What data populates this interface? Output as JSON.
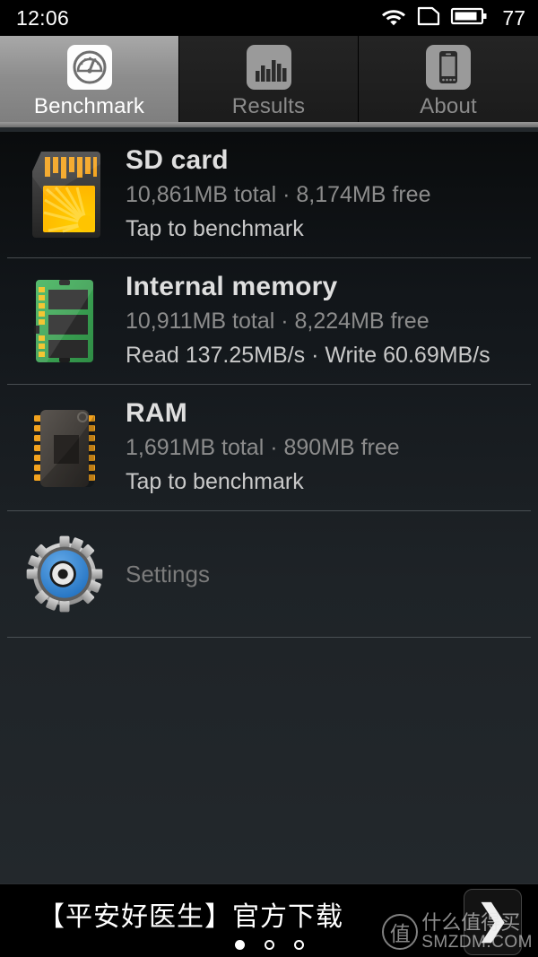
{
  "status_bar": {
    "time": "12:06",
    "battery_percent": "77",
    "icons": [
      "wifi-icon",
      "sim-card-icon",
      "battery-icon"
    ]
  },
  "tabs": [
    {
      "label": "Benchmark",
      "icon": "speedometer-icon",
      "active": true
    },
    {
      "label": "Results",
      "icon": "bar-chart-icon",
      "active": false
    },
    {
      "label": "About",
      "icon": "phone-icon",
      "active": false
    }
  ],
  "list": [
    {
      "id": "sd-card",
      "icon": "sd-card-icon",
      "title": "SD card",
      "subtitle": "10,861MB total · 8,174MB free",
      "action": "Tap to benchmark"
    },
    {
      "id": "internal-memory",
      "icon": "memory-module-icon",
      "title": "Internal memory",
      "subtitle": "10,911MB total · 8,224MB free",
      "action": "Read 137.25MB/s · Write 60.69MB/s"
    },
    {
      "id": "ram",
      "icon": "ram-chip-icon",
      "title": "RAM",
      "subtitle": "1,691MB total · 890MB free",
      "action": "Tap to benchmark"
    }
  ],
  "settings": {
    "label": "Settings",
    "icon": "gear-eye-icon"
  },
  "ad": {
    "text": "【平安好医生】官方下载",
    "cta_icon": "chevron-right-icon",
    "dots": [
      "filled",
      "hollow",
      "hollow"
    ]
  },
  "watermark": {
    "logo_char": "值",
    "chinese": "什么值得买",
    "site": "SMZDM.COM"
  },
  "colors": {
    "background": "#23282c",
    "status_bar": "#000000",
    "tab_active": "#8d8d8d",
    "title_text": "#dfdfdf",
    "subtitle_text": "#8c8c8c",
    "action_text": "#c9c9c9",
    "sd_accent": "#f5a623",
    "memory_accent": "#3faa55",
    "gear_accent": "#2f7fd0"
  }
}
